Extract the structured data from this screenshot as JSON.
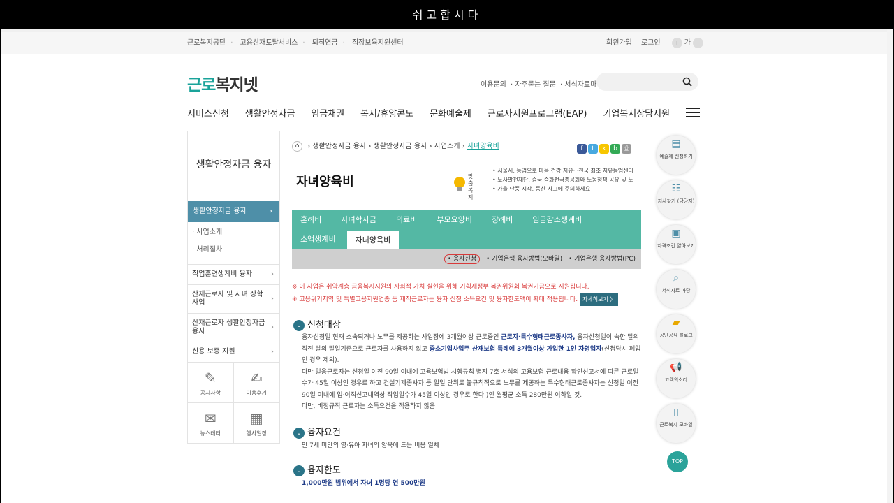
{
  "window_title": "쉬고합시다",
  "util_links": [
    "근로복지공단",
    "고용산재토탈서비스",
    "퇴직연금",
    "직장보육지원센터"
  ],
  "util_right": {
    "join": "회원가입",
    "login": "로그인",
    "plus": "+",
    "size": "가",
    "minus": "−"
  },
  "logo": {
    "a": "근로",
    "b": "복지넷"
  },
  "header_links": [
    "이용문의",
    "· 자주묻는 질문",
    "· 서식자료마당"
  ],
  "gnb": [
    "서비스신청",
    "생활안정자금",
    "임금채권",
    "복지/휴양콘도",
    "문화예술제",
    "근로자지원프로그램(EAP)",
    "기업복지상담지원"
  ],
  "lnb": {
    "title": "생활안정자금 융자",
    "active": "생활안정자금 융자",
    "sub": [
      "· 사업소개",
      "· 처리절차"
    ],
    "items": [
      "직업훈련생계비 융자",
      "산재근로자 및 자녀 장학사업",
      "산재근로자 생활안정자금 융자",
      "신용 보증 지원"
    ],
    "quick": [
      "공지사항",
      "이용후기",
      "뉴스레터",
      "행사일정"
    ]
  },
  "breadcrumb": [
    "생활안정자금 융자",
    "생활안정자금 융자",
    "사업소개",
    "자녀양육비"
  ],
  "page_title": "자녀양육비",
  "bulb_label": "맞춤복지",
  "notices": [
    "• 서울시, 농업으로 마음 건강 치유···전국 최초 치유농업센터",
    "• 노사발전재단, 중국 중화전국총공회와 노동정책 공유 및 노",
    "• 가을 단풍 시작, 등산 사고에 주의하세요"
  ],
  "tabs_row1": [
    "혼례비",
    "자녀학자금",
    "의료비",
    "부모요양비",
    "장례비",
    "임금감소생계비"
  ],
  "tabs_row2": [
    "소액생계비",
    "자녀양육비"
  ],
  "subtabs": [
    "• 융자신청",
    "• 기업은행 융자방법(모바일)",
    "• 기업은행 융자방법(PC)"
  ],
  "warn1": "※ 이 사업은 취약계층 금융복지지원의 사회적 가치 실현을 위해 기획재정부 복권위원회 복권기금으로 지원됩니다.",
  "warn2": "※ 고용위기지역 및 특별고용지원업종 등 재직근로자는 융자 신청 소득요건 및 융자한도액이 확대 적용됩니다.",
  "warn_btn": "자세히보기 〉",
  "sections": [
    {
      "title": "신청대상"
    },
    {
      "title": "융자요건"
    },
    {
      "title": "융자한도"
    }
  ],
  "para1": {
    "t1": "융자신청일 현재 소속되거나 노무를 제공하는 사업장에 3개월이상 근로중인 ",
    "b1": "근로자·특수형태근로종사자,",
    "t2": " 융자신청일이 속한 달의 직전 달의 말일기준으로 근로자를 사용하지 않고 ",
    "b2": "중소기업사업주 산재보험 특례에 3개월이상 가입한 1인 자영업자",
    "t3": "(신청당시 폐업인 경우 제외).",
    "t4": "다만 일용근로자는 신청일 이전 90일 이내에 고용보험법 시행규칙 별지 7호 서식의 고용보험 근로내용 확인신고서에 따른 근로일수가 45일 이상인 경우로 하고 건설기계종사자 등 일일 단위로 불규칙적으로 노무를 제공하는 특수형태근로종사자는 신청일 이전 90일 이내에 입·이직신고내역상 작업일수가 45일 이상인 경우로 한다.)인 월평균 소득 280만원 이하일 것.",
    "t5": "다만, 비정규직 근로자는 소득요건을 적용하지 않음"
  },
  "para2": "만 7세 미만의 영·유아 자녀의 양육에 드는 비용 일체",
  "para3": "1,000만원 범위에서 자녀 1명당 연 500만원",
  "right_quick": [
    "예술제 신청하기",
    "지사찾기 (담당자)",
    "자격조건 알아보기",
    "서식자료 마당",
    "공단공식 블로그",
    "고객의소리",
    "근로복지 모바일"
  ],
  "top_label": "TOP"
}
